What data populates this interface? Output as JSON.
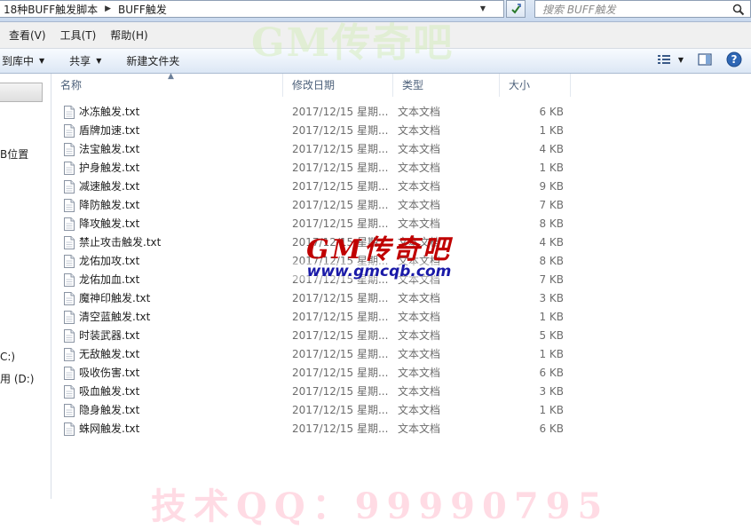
{
  "address_bar": {
    "crumbs": [
      "18种BUFF触发脚本",
      "BUFF触发"
    ],
    "search_placeholder": "搜索 BUFF触发"
  },
  "menu": [
    "查看(V)",
    "工具(T)",
    "帮助(H)"
  ],
  "toolbar": {
    "include_library": "到库中",
    "share": "共享",
    "new_folder": "新建文件夹"
  },
  "nav": {
    "items": [
      "B位置",
      "C:)",
      "用 (D:)"
    ]
  },
  "columns": [
    "名称",
    "修改日期",
    "类型",
    "大小"
  ],
  "files": [
    {
      "name": "冰冻触发.txt",
      "date": "2017/12/15 星期...",
      "type": "文本文档",
      "size": "6 KB"
    },
    {
      "name": "盾牌加速.txt",
      "date": "2017/12/15 星期...",
      "type": "文本文档",
      "size": "1 KB"
    },
    {
      "name": "法宝触发.txt",
      "date": "2017/12/15 星期...",
      "type": "文本文档",
      "size": "4 KB"
    },
    {
      "name": "护身触发.txt",
      "date": "2017/12/15 星期...",
      "type": "文本文档",
      "size": "1 KB"
    },
    {
      "name": "减速触发.txt",
      "date": "2017/12/15 星期...",
      "type": "文本文档",
      "size": "9 KB"
    },
    {
      "name": "降防触发.txt",
      "date": "2017/12/15 星期...",
      "type": "文本文档",
      "size": "7 KB"
    },
    {
      "name": "降攻触发.txt",
      "date": "2017/12/15 星期...",
      "type": "文本文档",
      "size": "8 KB"
    },
    {
      "name": "禁止攻击触发.txt",
      "date": "2017/12/15 星期...",
      "type": "文本文档",
      "size": "4 KB"
    },
    {
      "name": "龙佑加攻.txt",
      "date": "2017/12/15 星期...",
      "type": "文本文档",
      "size": "8 KB"
    },
    {
      "name": "龙佑加血.txt",
      "date": "2017/12/15 星期...",
      "type": "文本文档",
      "size": "7 KB"
    },
    {
      "name": "魔神印触发.txt",
      "date": "2017/12/15 星期...",
      "type": "文本文档",
      "size": "3 KB"
    },
    {
      "name": "清空蓝触发.txt",
      "date": "2017/12/15 星期...",
      "type": "文本文档",
      "size": "1 KB"
    },
    {
      "name": "时装武器.txt",
      "date": "2017/12/15 星期...",
      "type": "文本文档",
      "size": "5 KB"
    },
    {
      "name": "无敌触发.txt",
      "date": "2017/12/15 星期...",
      "type": "文本文档",
      "size": "1 KB"
    },
    {
      "name": "吸收伤害.txt",
      "date": "2017/12/15 星期...",
      "type": "文本文档",
      "size": "6 KB"
    },
    {
      "name": "吸血触发.txt",
      "date": "2017/12/15 星期...",
      "type": "文本文档",
      "size": "3 KB"
    },
    {
      "name": "隐身触发.txt",
      "date": "2017/12/15 星期...",
      "type": "文本文档",
      "size": "1 KB"
    },
    {
      "name": "蛛网触发.txt",
      "date": "2017/12/15 星期...",
      "type": "文本文档",
      "size": "6 KB"
    }
  ],
  "watermarks": {
    "top": "GM传奇吧",
    "center_title": "GM传奇吧",
    "center_url": "www.gmcqb.com",
    "bottom": "技术QQ：99990795"
  },
  "colors": {
    "accent": "#1e6fc2",
    "toolbar_bg": "#dce7f5",
    "watermark_red": "#c00000",
    "watermark_blue": "#1a1aa8"
  }
}
